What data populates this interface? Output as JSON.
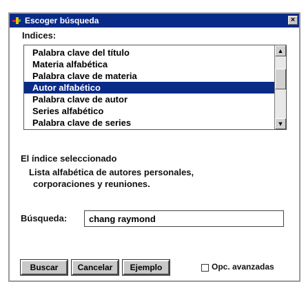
{
  "window": {
    "title": "Escoger búsqueda",
    "close_glyph": "×"
  },
  "indices": {
    "label": "Indices:",
    "items": [
      "Palabra clave del título",
      "Materia alfabética",
      "Palabra clave de materia",
      "Autor alfabético",
      "Palabra clave de autor",
      "Series alfabético",
      "Palabra clave de series"
    ],
    "selected_index": 3,
    "scroll_up_glyph": "▲",
    "scroll_down_glyph": "▼"
  },
  "selected_info": {
    "label": "El índice seleccionado",
    "description_line1": "Lista alfabética de autores personales,",
    "description_line2": "corporaciones y reuniones."
  },
  "search": {
    "label": "Búsqueda:",
    "value": "chang raymond"
  },
  "buttons": {
    "search_label": "Buscar",
    "cancel_label": "Cancelar",
    "example_label": "Ejemplo"
  },
  "advanced": {
    "label": "Opc. avanzadas",
    "checked": false
  },
  "colors": {
    "titlebar": "#0a2a88",
    "selection": "#0a2a88",
    "button_face": "#c8c8c8"
  }
}
